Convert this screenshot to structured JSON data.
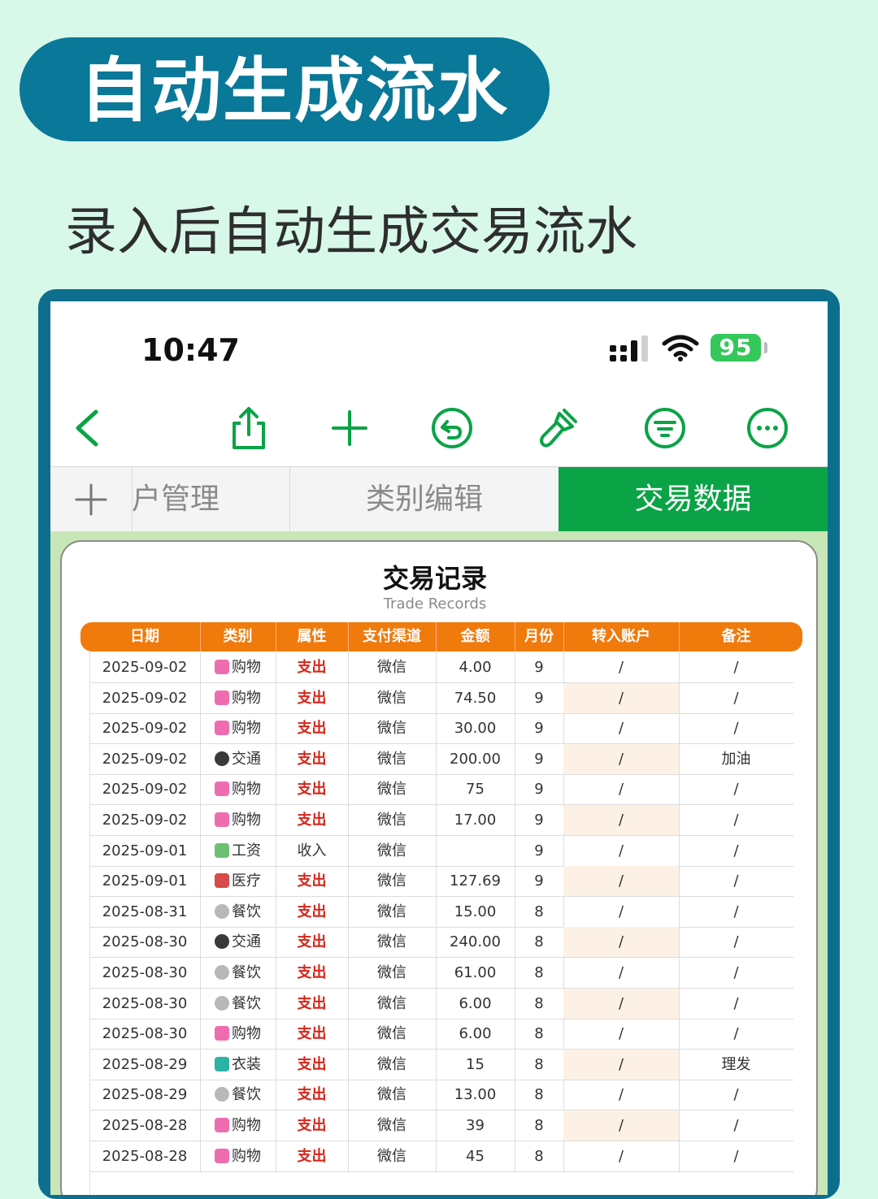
{
  "banner": {
    "title": "自动生成流水"
  },
  "subtitle": "录入后自动生成交易流水",
  "status_bar": {
    "time": "10:47",
    "battery": "95"
  },
  "toolbar": {
    "icons": [
      "back-icon",
      "share-icon",
      "add-icon",
      "undo-icon",
      "brush-icon",
      "filter-icon",
      "more-icon"
    ],
    "accent_color": "#0aa346"
  },
  "tabs": [
    {
      "label": "户管理"
    },
    {
      "label": "类别编辑"
    },
    {
      "label": "交易数据"
    }
  ],
  "table": {
    "title": "交易记录",
    "subtitle": "Trade Records",
    "columns": [
      "日期",
      "类别",
      "属性",
      "支付渠道",
      "金额",
      "月份",
      "转入账户",
      "备注"
    ],
    "rows": [
      {
        "date": "2025-09-02",
        "category": "购物",
        "icon": "shopping-bag-icon",
        "type": "支出",
        "channel": "微信",
        "amount": "4.00",
        "month": "9",
        "to_account": "/",
        "note": "/"
      },
      {
        "date": "2025-09-02",
        "category": "购物",
        "icon": "shopping-bag-icon",
        "type": "支出",
        "channel": "微信",
        "amount": "74.50",
        "month": "9",
        "to_account": "/",
        "note": "/"
      },
      {
        "date": "2025-09-02",
        "category": "购物",
        "icon": "shopping-bag-icon",
        "type": "支出",
        "channel": "微信",
        "amount": "30.00",
        "month": "9",
        "to_account": "/",
        "note": "/"
      },
      {
        "date": "2025-09-02",
        "category": "交通",
        "icon": "train-icon",
        "type": "支出",
        "channel": "微信",
        "amount": "200.00",
        "month": "9",
        "to_account": "/",
        "note": "加油"
      },
      {
        "date": "2025-09-02",
        "category": "购物",
        "icon": "shopping-bag-icon",
        "type": "支出",
        "channel": "微信",
        "amount": "75",
        "month": "9",
        "to_account": "/",
        "note": "/"
      },
      {
        "date": "2025-09-02",
        "category": "购物",
        "icon": "shopping-bag-icon",
        "type": "支出",
        "channel": "微信",
        "amount": "17.00",
        "month": "9",
        "to_account": "/",
        "note": "/"
      },
      {
        "date": "2025-09-01",
        "category": "工资",
        "icon": "money-icon",
        "type": "收入",
        "channel": "微信",
        "amount": "",
        "month": "9",
        "to_account": "/",
        "note": "/"
      },
      {
        "date": "2025-09-01",
        "category": "医疗",
        "icon": "hospital-icon",
        "type": "支出",
        "channel": "微信",
        "amount": "127.69",
        "month": "9",
        "to_account": "/",
        "note": "/"
      },
      {
        "date": "2025-08-31",
        "category": "餐饮",
        "icon": "bowl-icon",
        "type": "支出",
        "channel": "微信",
        "amount": "15.00",
        "month": "8",
        "to_account": "/",
        "note": "/"
      },
      {
        "date": "2025-08-30",
        "category": "交通",
        "icon": "train-icon",
        "type": "支出",
        "channel": "微信",
        "amount": "240.00",
        "month": "8",
        "to_account": "/",
        "note": "/"
      },
      {
        "date": "2025-08-30",
        "category": "餐饮",
        "icon": "bowl-icon",
        "type": "支出",
        "channel": "微信",
        "amount": "61.00",
        "month": "8",
        "to_account": "/",
        "note": "/"
      },
      {
        "date": "2025-08-30",
        "category": "餐饮",
        "icon": "bowl-icon",
        "type": "支出",
        "channel": "微信",
        "amount": "6.00",
        "month": "8",
        "to_account": "/",
        "note": "/"
      },
      {
        "date": "2025-08-30",
        "category": "购物",
        "icon": "shopping-bag-icon",
        "type": "支出",
        "channel": "微信",
        "amount": "6.00",
        "month": "8",
        "to_account": "/",
        "note": "/"
      },
      {
        "date": "2025-08-29",
        "category": "衣装",
        "icon": "dress-icon",
        "type": "支出",
        "channel": "微信",
        "amount": "15",
        "month": "8",
        "to_account": "/",
        "note": "理发"
      },
      {
        "date": "2025-08-29",
        "category": "餐饮",
        "icon": "bowl-icon",
        "type": "支出",
        "channel": "微信",
        "amount": "13.00",
        "month": "8",
        "to_account": "/",
        "note": "/"
      },
      {
        "date": "2025-08-28",
        "category": "购物",
        "icon": "shopping-bag-icon",
        "type": "支出",
        "channel": "微信",
        "amount": "39",
        "month": "8",
        "to_account": "/",
        "note": "/"
      },
      {
        "date": "2025-08-28",
        "category": "购物",
        "icon": "shopping-bag-icon",
        "type": "支出",
        "channel": "微信",
        "amount": "45",
        "month": "8",
        "to_account": "/",
        "note": "/"
      }
    ]
  }
}
